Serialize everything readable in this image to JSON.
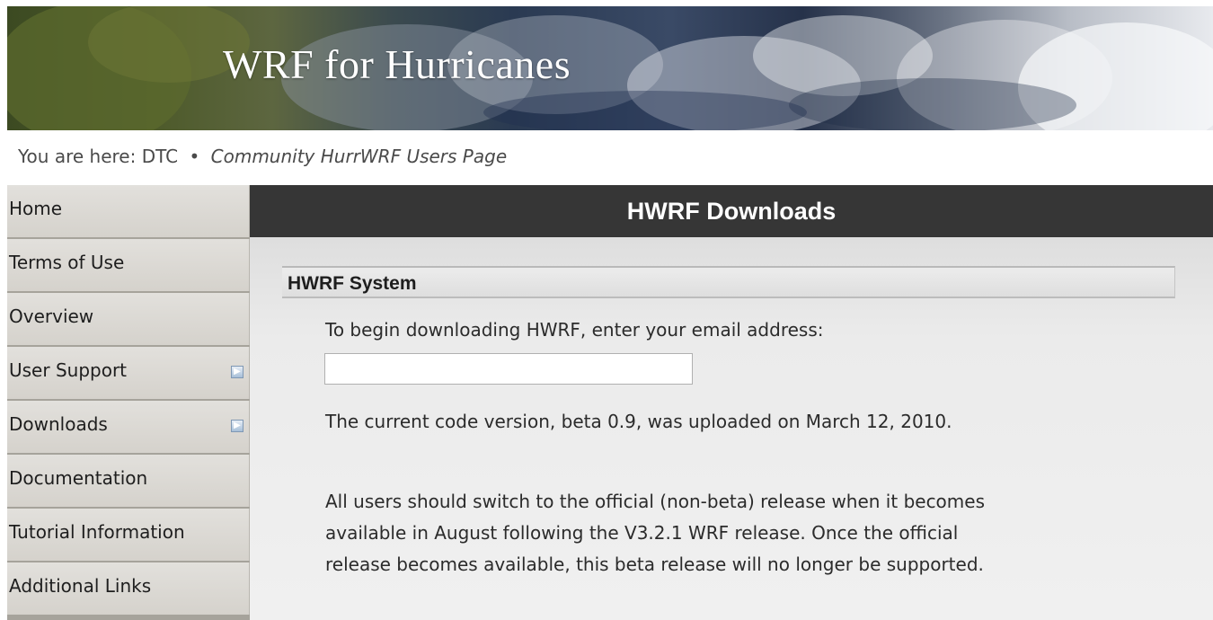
{
  "banner": {
    "title": "WRF for Hurricanes"
  },
  "breadcrumb": {
    "prefix": "You are here:",
    "root": "DTC",
    "separator": "•",
    "current": "Community HurrWRF Users Page"
  },
  "sidebar": {
    "items": [
      {
        "label": "Home",
        "has_submenu": false
      },
      {
        "label": "Terms of Use",
        "has_submenu": false
      },
      {
        "label": "Overview",
        "has_submenu": false
      },
      {
        "label": "User Support",
        "has_submenu": true
      },
      {
        "label": "Downloads",
        "has_submenu": true
      },
      {
        "label": "Documentation",
        "has_submenu": false
      },
      {
        "label": "Tutorial Information",
        "has_submenu": false
      },
      {
        "label": "Additional Links",
        "has_submenu": false
      }
    ]
  },
  "main": {
    "header": "HWRF Downloads",
    "section_title": "HWRF System",
    "email_prompt": "To begin downloading HWRF, enter your email address:",
    "email_value": "",
    "version_text": "The current code version, beta 0.9, was uploaded on March 12, 2010.",
    "notice_lines": [
      "All users should switch to the official (non-beta) release when it becomes",
      "available in August following the V3.2.1 WRF release. Once the official",
      "release becomes available, this beta release will no longer be supported."
    ]
  },
  "colors": {
    "header_bg": "#363636",
    "sidebar_item_bg": "#dad8d3",
    "content_bg": "#ececec",
    "submenu_arrow": "#a7bfd8"
  }
}
